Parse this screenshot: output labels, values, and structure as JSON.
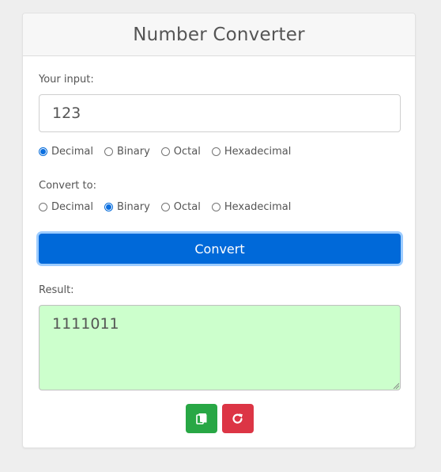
{
  "app": {
    "title": "Number Converter"
  },
  "input": {
    "label": "Your input:",
    "value": "123"
  },
  "from": {
    "options": [
      "Decimal",
      "Binary",
      "Octal",
      "Hexadecimal"
    ],
    "selected": "Decimal"
  },
  "to": {
    "label": "Convert to:",
    "options": [
      "Decimal",
      "Binary",
      "Octal",
      "Hexadecimal"
    ],
    "selected": "Binary"
  },
  "convert": {
    "label": "Convert"
  },
  "result": {
    "label": "Result:",
    "value": "1111011"
  },
  "actions": {
    "copy_icon": "copy-icon",
    "reset_icon": "redo-icon"
  },
  "colors": {
    "primary": "#0069d9",
    "success": "#28a745",
    "danger": "#dc3545",
    "result_bg": "#ccffcc"
  }
}
